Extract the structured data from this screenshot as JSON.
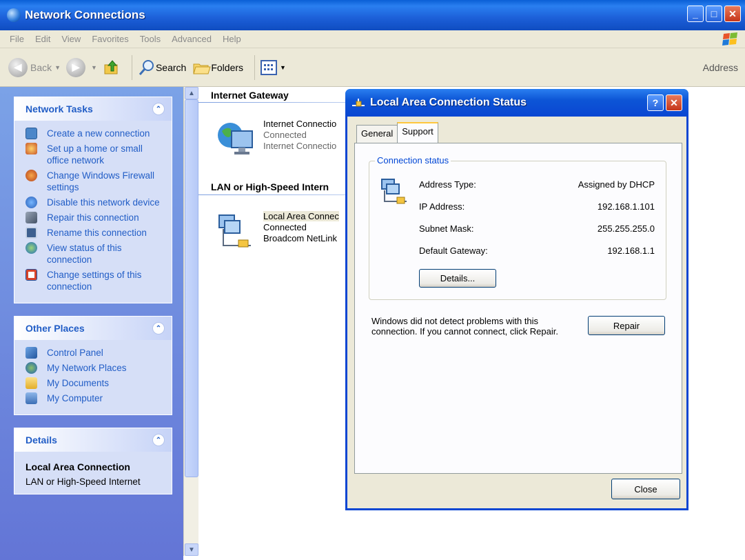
{
  "window": {
    "title": "Network Connections"
  },
  "menu": [
    "File",
    "Edit",
    "View",
    "Favorites",
    "Tools",
    "Advanced",
    "Help"
  ],
  "toolbar": {
    "back": "Back",
    "search": "Search",
    "folders": "Folders",
    "address": "Address"
  },
  "panels": {
    "network_tasks": {
      "title": "Network Tasks",
      "items": [
        {
          "label": "Create a new connection",
          "icon": "new-connection-icon"
        },
        {
          "label": "Set up a home or small office network",
          "icon": "home-network-icon"
        },
        {
          "label": "Change Windows Firewall settings",
          "icon": "firewall-icon"
        },
        {
          "label": "Disable this network device",
          "icon": "disable-icon"
        },
        {
          "label": "Repair this connection",
          "icon": "repair-icon"
        },
        {
          "label": "Rename this connection",
          "icon": "rename-icon"
        },
        {
          "label": "View status of this connection",
          "icon": "status-icon"
        },
        {
          "label": "Change settings of this connection",
          "icon": "settings-icon"
        }
      ]
    },
    "other_places": {
      "title": "Other Places",
      "items": [
        {
          "label": "Control Panel",
          "icon": "control-panel-icon"
        },
        {
          "label": "My Network Places",
          "icon": "network-places-icon"
        },
        {
          "label": "My Documents",
          "icon": "documents-icon"
        },
        {
          "label": "My Computer",
          "icon": "computer-icon"
        }
      ]
    },
    "details": {
      "title": "Details",
      "name": "Local Area Connection",
      "type": "LAN or High-Speed Internet"
    }
  },
  "groups": {
    "gateway": {
      "title": "Internet Gateway",
      "item": {
        "line1": "Internet Connectio",
        "line2": "Connected",
        "line3": "Internet Connectio"
      }
    },
    "lan": {
      "title": "LAN or High-Speed Intern",
      "item": {
        "line1": "Local Area Connec",
        "line2": "Connected",
        "line3": "Broadcom NetLink"
      }
    }
  },
  "dialog": {
    "title": "Local Area Connection Status",
    "tabs": [
      "General",
      "Support"
    ],
    "active_tab": "Support",
    "legend": "Connection status",
    "fields": [
      {
        "key": "Address Type:",
        "value": "Assigned by DHCP"
      },
      {
        "key": "IP Address:",
        "value": "192.168.1.101"
      },
      {
        "key": "Subnet Mask:",
        "value": "255.255.255.0"
      },
      {
        "key": "Default Gateway:",
        "value": "192.168.1.1"
      }
    ],
    "details_button": "Details...",
    "message": "Windows did not detect problems with this connection. If you cannot connect, click Repair.",
    "repair_button": "Repair",
    "close_button": "Close"
  },
  "colors": {
    "titlebar": "#0a46d2",
    "task_link": "#215dc6",
    "legend": "#0046d5"
  }
}
